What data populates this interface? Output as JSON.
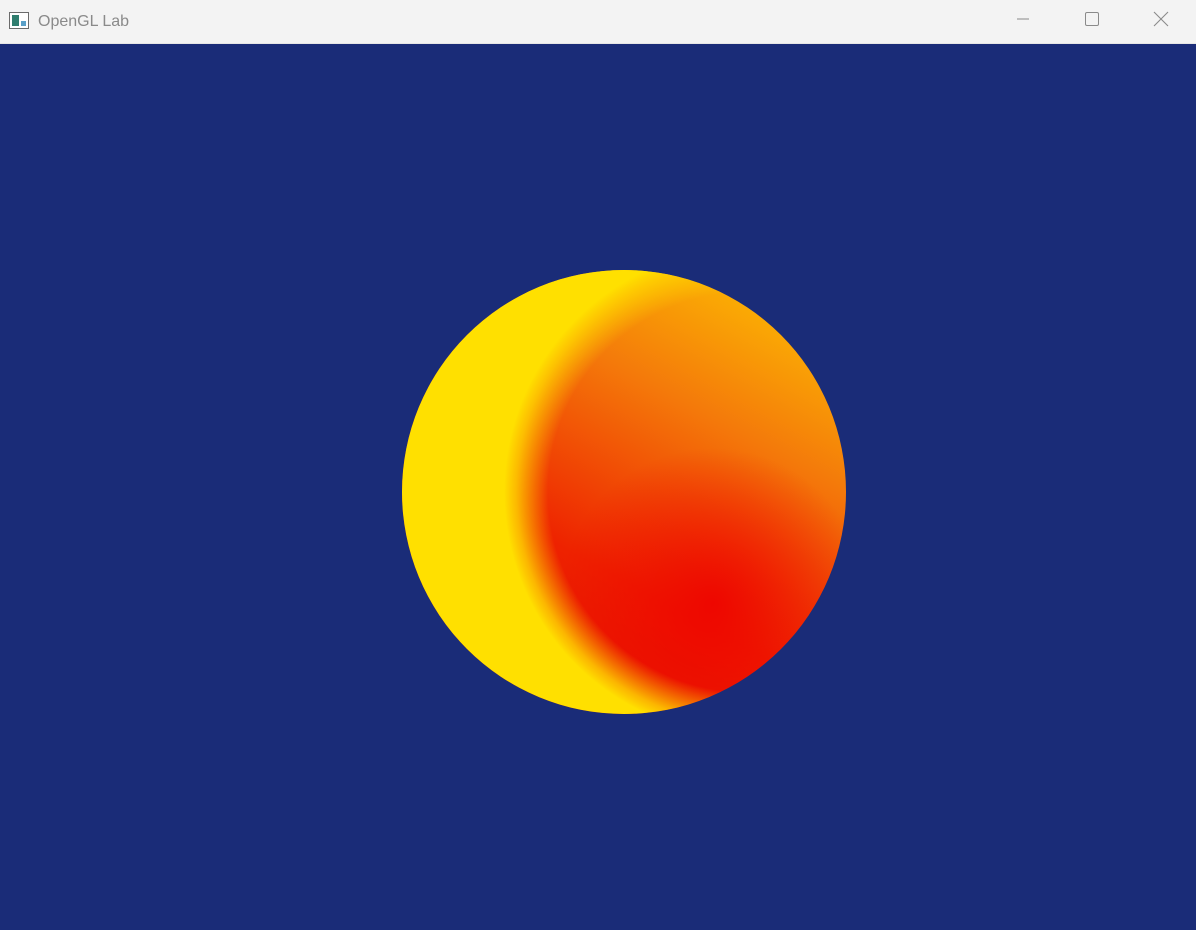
{
  "window": {
    "title": "OpenGL Lab",
    "icons": {
      "app": "app-window-icon",
      "minimize": "minimize-icon",
      "maximize": "maximize-icon",
      "close": "close-icon"
    }
  },
  "scene": {
    "background_color": "#1a2c78",
    "object": "sphere",
    "colors": {
      "highlight": "#ffcc00",
      "mid": "#f07010",
      "shadow": "#ee0a00"
    }
  }
}
